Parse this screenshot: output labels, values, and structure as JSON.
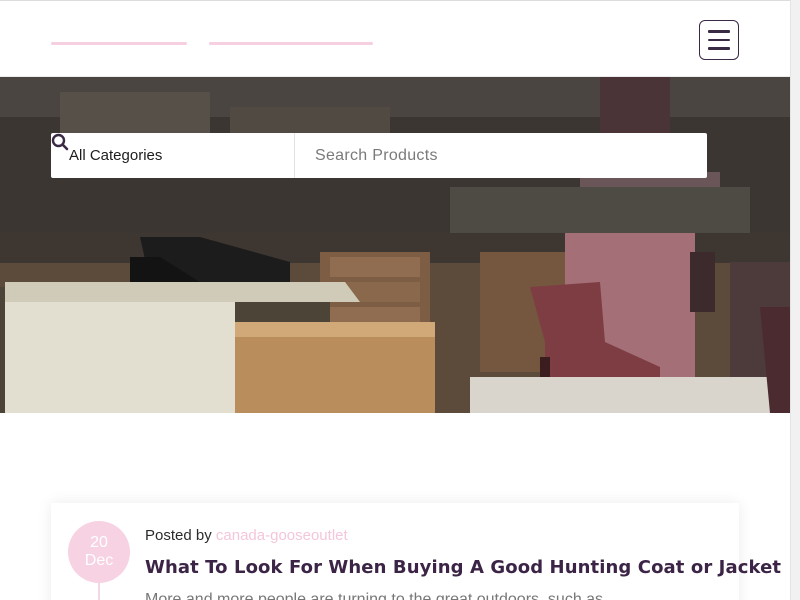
{
  "header": {
    "menu_label": "menu"
  },
  "search": {
    "category_selected": "All Categories",
    "placeholder": "Search Products"
  },
  "post": {
    "date_day": "20",
    "date_month": "Dec",
    "posted_by_label": "Posted by",
    "author": "canada-gooseoutlet",
    "title": "What To Look For When Buying A Good Hunting Coat or Jacket",
    "excerpt": "More and more people are turning to the great outdoors, such as"
  },
  "colors": {
    "accent_pink": "#f7d2e3",
    "title_purple": "#3b2445"
  },
  "icons": {
    "menu": "hamburger-icon",
    "search": "search-icon"
  }
}
